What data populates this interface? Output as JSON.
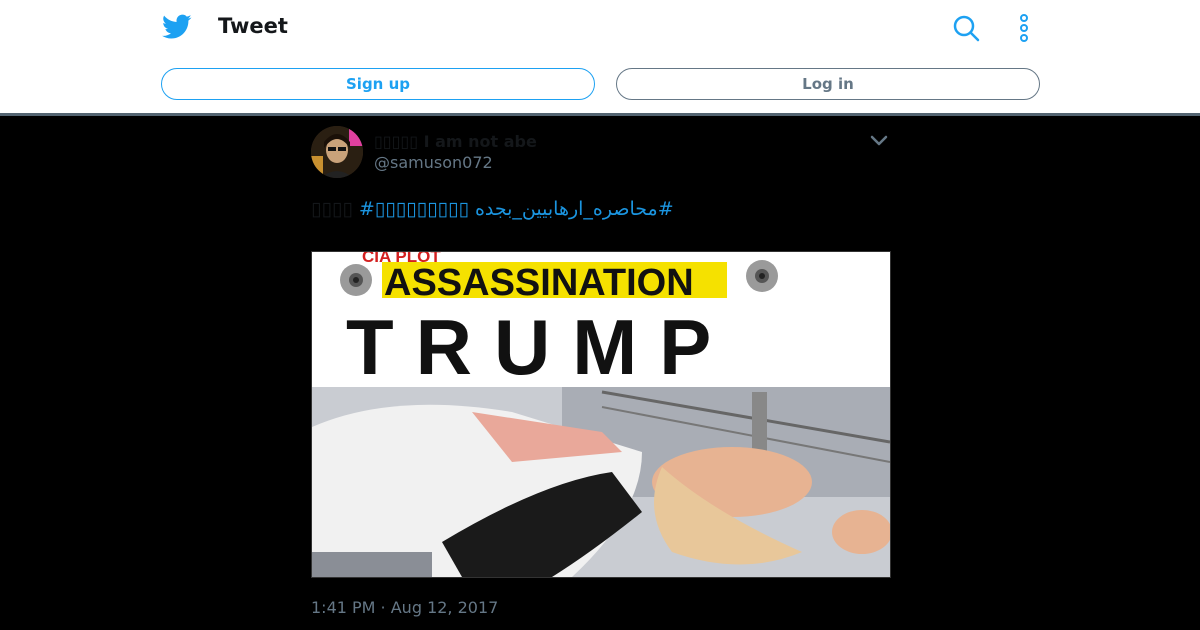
{
  "header": {
    "title": "Tweet",
    "icons": {
      "logo": "twitter-bird-icon",
      "search": "search-icon",
      "more": "more-vertical-icon"
    },
    "signup_label": "Sign up",
    "login_label": "Log in"
  },
  "tweet": {
    "display_name": "▯▯▯▯▯ I am not abe",
    "handle": "@samuson072",
    "text_prefix": "▯▯▯▯",
    "hashtag_1": "#▯▯▯▯▯▯▯▯▯",
    "hashtag_2": "#محاصره_ارهابيين_بجده",
    "time": "1:41 PM",
    "separator": " · ",
    "date": "Aug 12, 2017",
    "media": {
      "banner_text": "CIA PLOT",
      "headline": "ASSASSINATION",
      "subject": "TRUMP"
    }
  },
  "colors": {
    "accent": "#1da1f2",
    "link": "#1b95e0",
    "muted": "#657786",
    "background": "#000000"
  }
}
